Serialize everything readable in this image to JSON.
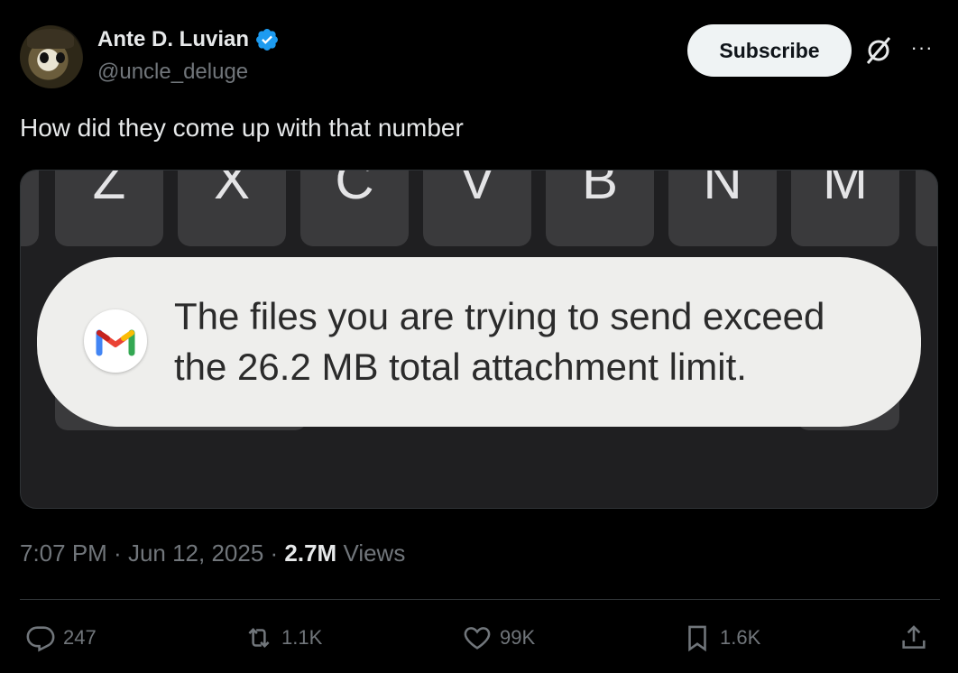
{
  "author": {
    "name": "Ante D. Luvian",
    "handle": "@uncle_deluge",
    "verified": true,
    "verified_color": "#1d9bf0"
  },
  "header": {
    "subscribe_label": "Subscribe",
    "grok_icon": "grok-icon",
    "more_label": "···"
  },
  "tweet": {
    "text": "How did they come up with that number"
  },
  "media": {
    "keys": [
      "Z",
      "X",
      "C",
      "V",
      "B",
      "N",
      "M"
    ],
    "toast_line1": "The files you are trying to send exceed",
    "toast_line2": "the 26.2 MB total attachment limit.",
    "toast_icon": "gmail-icon"
  },
  "meta": {
    "time": "7:07 PM",
    "sep1": " · ",
    "date": "Jun 12, 2025",
    "sep2": " · ",
    "views_count": "2.7M",
    "views_label": " Views"
  },
  "actions": {
    "replies": "247",
    "reposts": "1.1K",
    "likes": "99K",
    "bookmarks": "1.6K"
  }
}
